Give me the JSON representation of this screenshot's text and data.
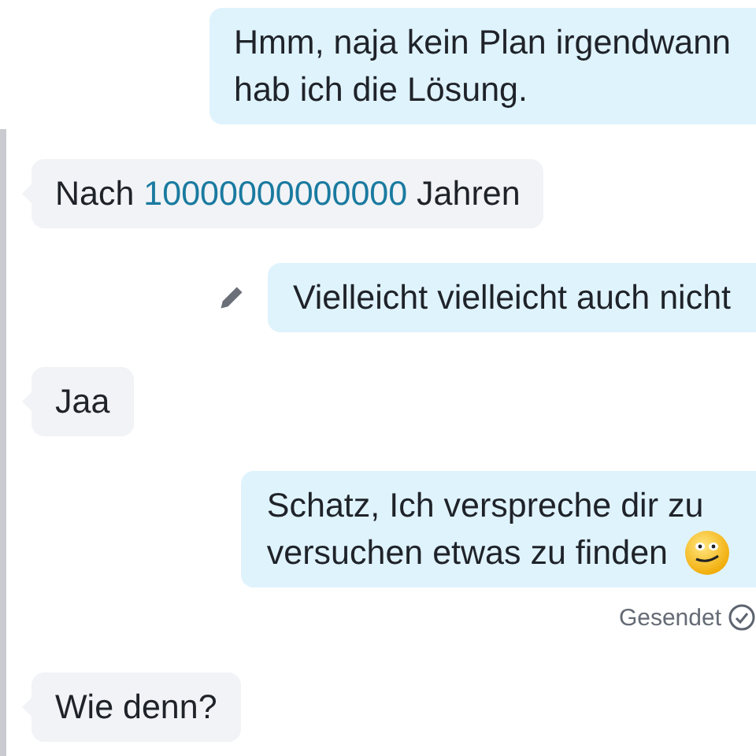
{
  "messages": [
    {
      "kind": "outgoing",
      "edited": false,
      "lines": [
        {
          "segments": [
            {
              "kind": "text",
              "text": "Hmm, naja kein Plan irgendwann"
            }
          ]
        },
        {
          "segments": [
            {
              "kind": "text",
              "text": "hab ich die Lösung."
            }
          ]
        }
      ]
    },
    {
      "kind": "incoming",
      "edited": false,
      "lines": [
        {
          "segments": [
            {
              "kind": "text",
              "text": "Nach "
            },
            {
              "kind": "link",
              "text": "10000000000000"
            },
            {
              "kind": "text",
              "text": " Jahren"
            }
          ]
        }
      ]
    },
    {
      "kind": "outgoing",
      "edited": true,
      "lines": [
        {
          "segments": [
            {
              "kind": "text",
              "text": "Vielleicht vielleicht auch nicht"
            }
          ]
        }
      ]
    },
    {
      "kind": "incoming",
      "edited": false,
      "lines": [
        {
          "segments": [
            {
              "kind": "text",
              "text": "Jaa"
            }
          ]
        }
      ]
    },
    {
      "kind": "outgoing",
      "edited": false,
      "status": "Gesendet",
      "lines": [
        {
          "segments": [
            {
              "kind": "text",
              "text": "Schatz, Ich verspreche dir zu"
            }
          ]
        },
        {
          "segments": [
            {
              "kind": "text",
              "text": "versuchen etwas zu finden"
            },
            {
              "kind": "emoji"
            }
          ]
        }
      ]
    },
    {
      "kind": "incoming",
      "edited": false,
      "lines": [
        {
          "segments": [
            {
              "kind": "text",
              "text": "Wie denn?"
            }
          ]
        }
      ]
    }
  ]
}
